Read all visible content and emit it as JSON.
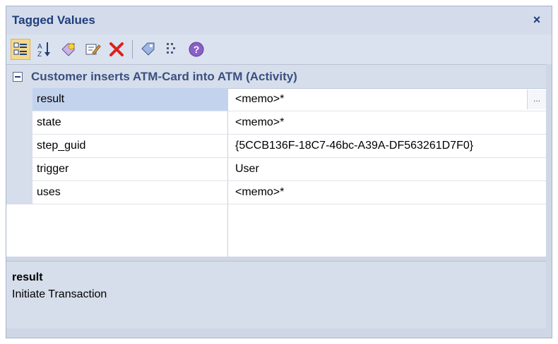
{
  "window": {
    "title": "Tagged Values",
    "close_label": "×"
  },
  "toolbar": {
    "buttons": [
      {
        "name": "categorized-view-icon"
      },
      {
        "name": "alphabetic-sort-icon"
      },
      {
        "name": "new-tag-icon"
      },
      {
        "name": "edit-tag-icon"
      },
      {
        "name": "delete-tag-icon"
      },
      {
        "name": "tag-value-icon"
      },
      {
        "name": "show-duplicates-icon"
      },
      {
        "name": "help-icon"
      }
    ]
  },
  "grid": {
    "category": "Customer inserts ATM-Card into ATM (Activity)",
    "rows": [
      {
        "name": "result",
        "value": "<memo>*",
        "selected": true
      },
      {
        "name": "state",
        "value": "<memo>*"
      },
      {
        "name": "step_guid",
        "value": "{5CCB136F-18C7-46bc-A39A-DF563261D7F0}"
      },
      {
        "name": "trigger",
        "value": "User"
      },
      {
        "name": "uses",
        "value": "<memo>*"
      }
    ],
    "ellipsis_label": "..."
  },
  "description": {
    "title": "result",
    "text": "Initiate Transaction"
  },
  "colors": {
    "title": "#1e3d7a",
    "delete": "#d9231c",
    "selection": "#c3d3ee"
  }
}
